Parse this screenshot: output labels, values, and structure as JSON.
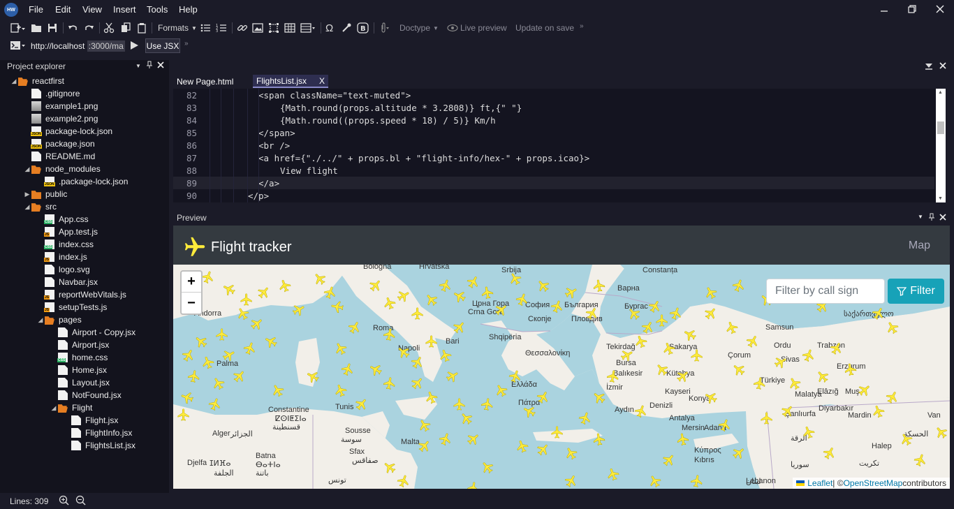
{
  "menu": [
    "File",
    "Edit",
    "View",
    "Insert",
    "Tools",
    "Help"
  ],
  "app_logo": "HW",
  "toolbar": {
    "formats": "Formats",
    "doctype": "Doctype",
    "live_preview": "Live preview",
    "update_on_save": "Update on save"
  },
  "urlbar": {
    "url": "http://localhost",
    "port": ":3000/ma",
    "use_jsx": "Use JSX"
  },
  "project": {
    "title": "Project explorer",
    "tree": [
      {
        "label": "reactfirst",
        "icon": "folder-open"
      },
      {
        "label": ".gitignore",
        "icon": "file"
      },
      {
        "label": "example1.png",
        "icon": "img"
      },
      {
        "label": "example2.png",
        "icon": "img"
      },
      {
        "label": "package-lock.json",
        "icon": "json"
      },
      {
        "label": "package.json",
        "icon": "json"
      },
      {
        "label": "README.md",
        "icon": "file"
      },
      {
        "label": "node_modules",
        "icon": "folder-open"
      },
      {
        "label": ".package-lock.json",
        "icon": "json"
      },
      {
        "label": "public",
        "icon": "folder"
      },
      {
        "label": "src",
        "icon": "folder-open"
      },
      {
        "label": "App.css",
        "icon": "css"
      },
      {
        "label": "App.test.js",
        "icon": "js"
      },
      {
        "label": "index.css",
        "icon": "css"
      },
      {
        "label": "index.js",
        "icon": "js"
      },
      {
        "label": "logo.svg",
        "icon": "file"
      },
      {
        "label": "Navbar.jsx",
        "icon": "file"
      },
      {
        "label": "reportWebVitals.js",
        "icon": "js"
      },
      {
        "label": "setupTests.js",
        "icon": "js"
      },
      {
        "label": "pages",
        "icon": "folder-open"
      },
      {
        "label": "Airport - Copy.jsx",
        "icon": "file"
      },
      {
        "label": "Airport.jsx",
        "icon": "file"
      },
      {
        "label": "home.css",
        "icon": "css"
      },
      {
        "label": "Home.jsx",
        "icon": "file"
      },
      {
        "label": "Layout.jsx",
        "icon": "file"
      },
      {
        "label": "NotFound.jsx",
        "icon": "file"
      },
      {
        "label": "Flight",
        "icon": "folder-open"
      },
      {
        "label": "Flight.jsx",
        "icon": "file"
      },
      {
        "label": "FlightInfo.jsx",
        "icon": "file"
      },
      {
        "label": "FlightsList.jsx",
        "icon": "file"
      }
    ]
  },
  "status": {
    "lines": "Lines: 309"
  },
  "editor": {
    "tabs": [
      {
        "label": "New Page.html"
      },
      {
        "label": "FlightsList.jsx",
        "close": "X"
      }
    ],
    "line_numbers": [
      "82",
      "83",
      "84",
      "85",
      "86",
      "87",
      "88",
      "89",
      "90"
    ],
    "code": [
      "<span className=\"text-muted\">",
      "  {Math.round(props.altitude * 3.2808)} ft,{\" \"}",
      "  {Math.round((props.speed * 18) / 5)} Km/h",
      "</span>",
      "<br />",
      "<a href={\"./../\" + props.bl + \"flight-info/hex-\" + props.icao}>",
      "  View flight",
      "</a>",
      "</p>"
    ]
  },
  "preview": {
    "title": "Preview",
    "brand": "Flight tracker",
    "nav_link": "Map",
    "zoom_in": "+",
    "zoom_out": "−",
    "filter_placeholder": "Filter by call sign",
    "filter_button": "Filter",
    "attribution": {
      "leaflet": "Leaflet",
      "sep": " | © ",
      "osm": "OpenStreetMap",
      "contributors": " contributors"
    },
    "map_labels": [
      "Bologna",
      "Hrvatska",
      "Srbija",
      "Constanța",
      "Црна Гора",
      "Crna Gora",
      "София",
      "България",
      "Варна",
      "Andorra",
      "Roma",
      "Скопје",
      "Пловдив",
      "Бургас",
      "Samsun",
      "საქართველო",
      "Shqipëria",
      "Bari",
      "Napoli",
      "Θεσσαλονίκη",
      "Tekirdağ",
      "Sakarya",
      "Ordu",
      "Trabzon",
      "Palma",
      "Bursa",
      "Çorum",
      "Sivas",
      "Erzurum",
      "Balıkesir",
      "Kütahya",
      "Türkiye",
      "Ελλάδα",
      "Elâzığ",
      "Muş",
      "İzmir",
      "Kayseri",
      "Malatya",
      "Diyarbakır",
      "Constantine",
      "ⵇⵙⵏⵟⵉⵏⴰ",
      "قسنطينة",
      "Πάτρα",
      "Denizli",
      "Konya",
      "Tunis",
      "Aydın",
      "Alger",
      "الجزائر",
      "Antalya",
      "Şanlıurfa",
      "Mardin",
      "Sousse",
      "سوسة",
      "Malta",
      "Batna",
      "ⴱⴰⵜⵏⴰ",
      "باتنة",
      "Sfax",
      "صفاقس",
      "Djelfa",
      "ⵊⵍⴼⴰ",
      "الجلفة",
      "تونس",
      "Κύπρος",
      "Kıbrıs",
      "سوريا",
      "Lebanon",
      "لبنان",
      "الرقة",
      "تكريت",
      "Halep",
      "Adana",
      "Mersin",
      "الحسكة",
      "Erzurum",
      "Van"
    ]
  },
  "colors": {
    "sea": "#aad3df",
    "land": "#f2efe9",
    "plane": "#ffeb3b",
    "navbar": "#343a40",
    "filter_button": "#17a2b8"
  }
}
